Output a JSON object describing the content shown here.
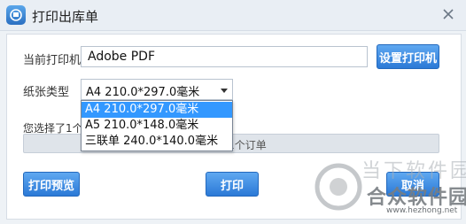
{
  "window": {
    "title": "打印出库单",
    "close_icon": "close-icon",
    "app_icon": "printer-app-icon"
  },
  "printer": {
    "label": "当前打印机",
    "value": "Adobe PDF",
    "setup_button": "设置打印机"
  },
  "paper": {
    "label": "纸张类型",
    "selected": "A4  210.0*297.0毫米",
    "options": [
      "A4  210.0*297.0毫米",
      "A5  210.0*148.0毫米",
      "三联单 240.0*140.0毫米"
    ]
  },
  "selection": {
    "info_prefix": "您选择了1个",
    "progress_text": "单，共1个订单"
  },
  "actions": {
    "preview": "打印预览",
    "print": "打印",
    "cancel": "取消"
  },
  "watermark": {
    "line1": "当下软件园",
    "line2": "合众软件园",
    "line3": "www.hezhong.net"
  },
  "colors": {
    "button_blue": "#2b79d6",
    "highlight": "#3398ff"
  }
}
